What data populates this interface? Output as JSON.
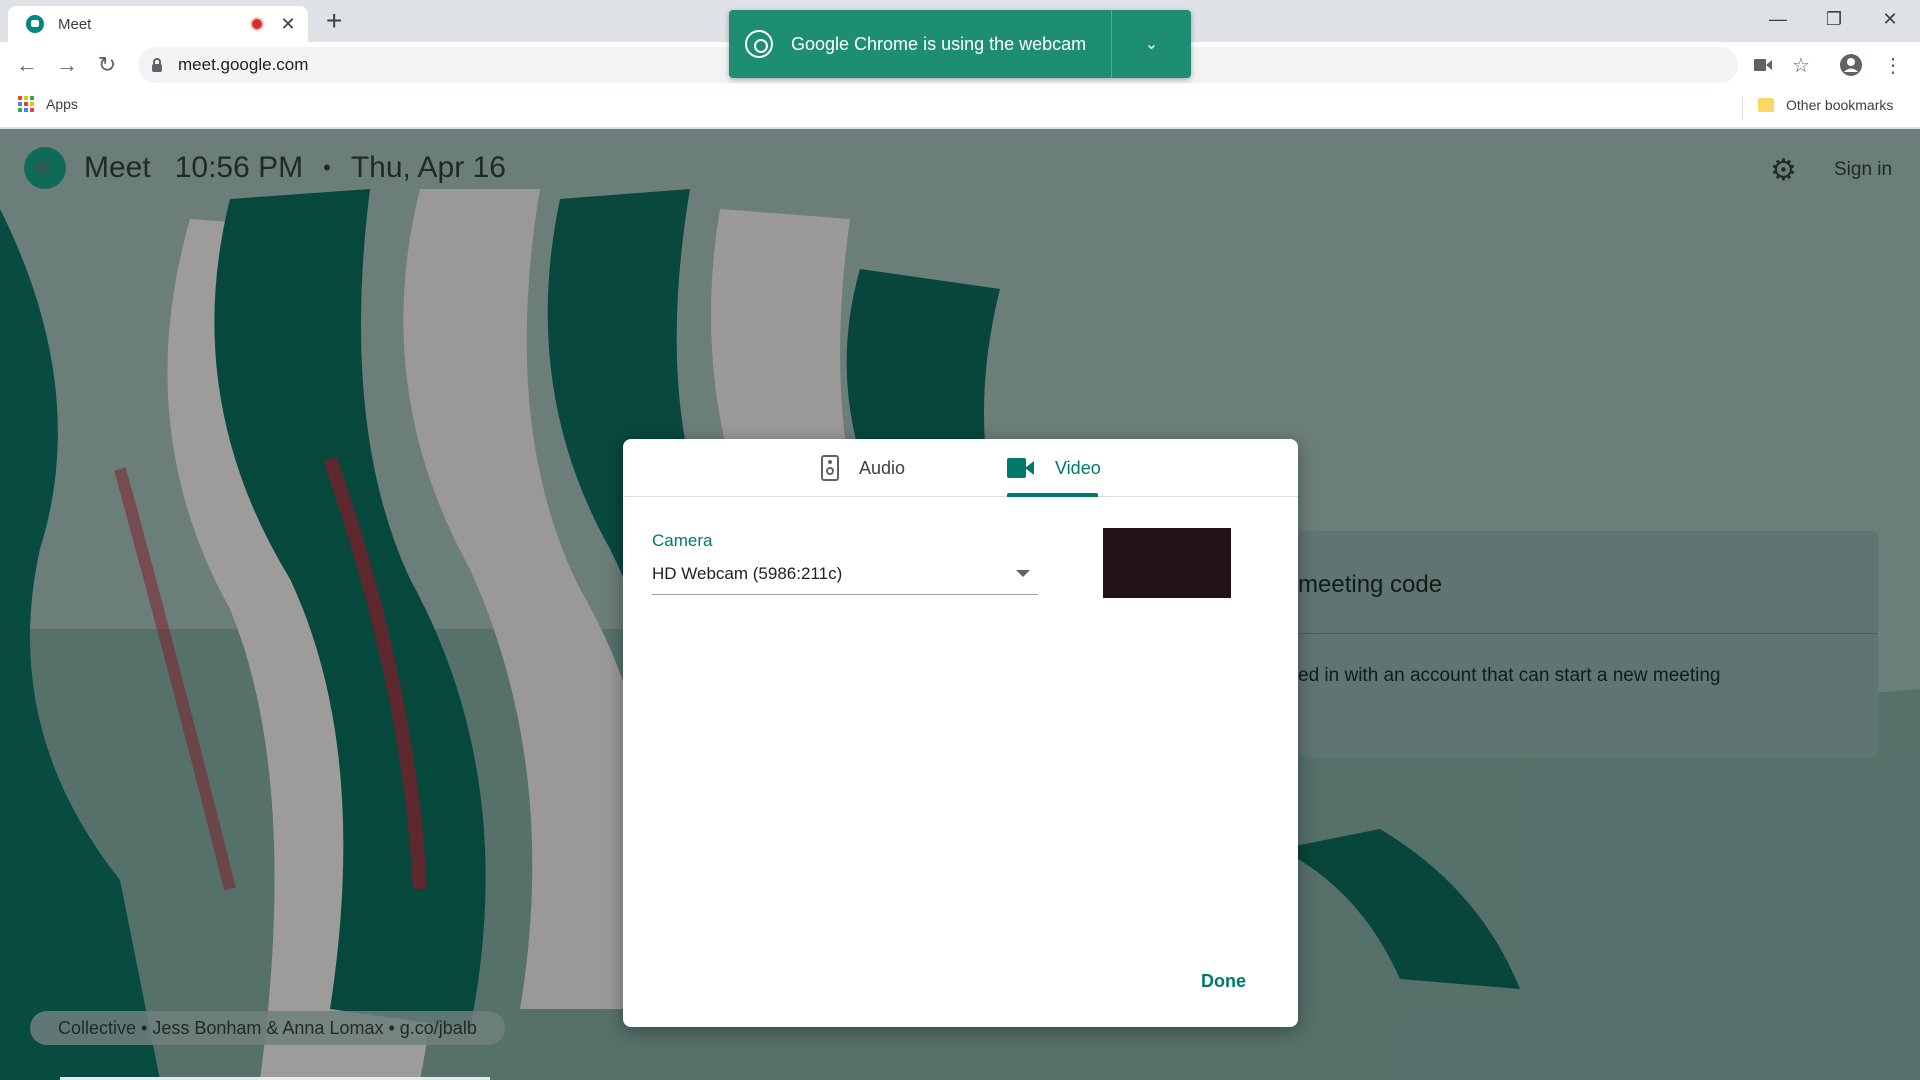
{
  "browser": {
    "tab_title": "Meet",
    "url": "meet.google.com",
    "bookmarks": {
      "apps_label": "Apps",
      "other_label": "Other bookmarks"
    },
    "webcam_notice": "Google Chrome is using the webcam",
    "icons": [
      "meet-favicon-icon",
      "record-indicator-icon",
      "close-icon",
      "plus-icon",
      "minimize-icon",
      "restore-icon",
      "close-window-icon",
      "back-icon",
      "forward-icon",
      "reload-icon",
      "lock-icon",
      "camera-indicator-icon",
      "star-icon",
      "profile-icon",
      "menu-dots-icon",
      "apps-grid-icon",
      "folder-icon",
      "webcam-icon",
      "chevron-down-icon"
    ]
  },
  "meet": {
    "title": "Meet",
    "time": "10:56 PM",
    "separator": "•",
    "date": "Thu, Apr 16",
    "sign_in": "Sign in",
    "join_code_text": "meeting code",
    "join_message": "ed in with an account that can start a new meeting",
    "credit": "Collective  •  Jess Bonham & Anna Lomax  •  g.co/jbalb"
  },
  "dialog": {
    "tabs": [
      {
        "label": "Audio",
        "icon": "speaker-icon",
        "active": false
      },
      {
        "label": "Video",
        "icon": "video-camera-icon",
        "active": true
      }
    ],
    "camera_label": "Camera",
    "camera_value": "HD Webcam (5986:211c)",
    "done_label": "Done"
  },
  "colors": {
    "accent": "#00796b",
    "toast": "#1e8e73",
    "background": "#2f5a53"
  }
}
